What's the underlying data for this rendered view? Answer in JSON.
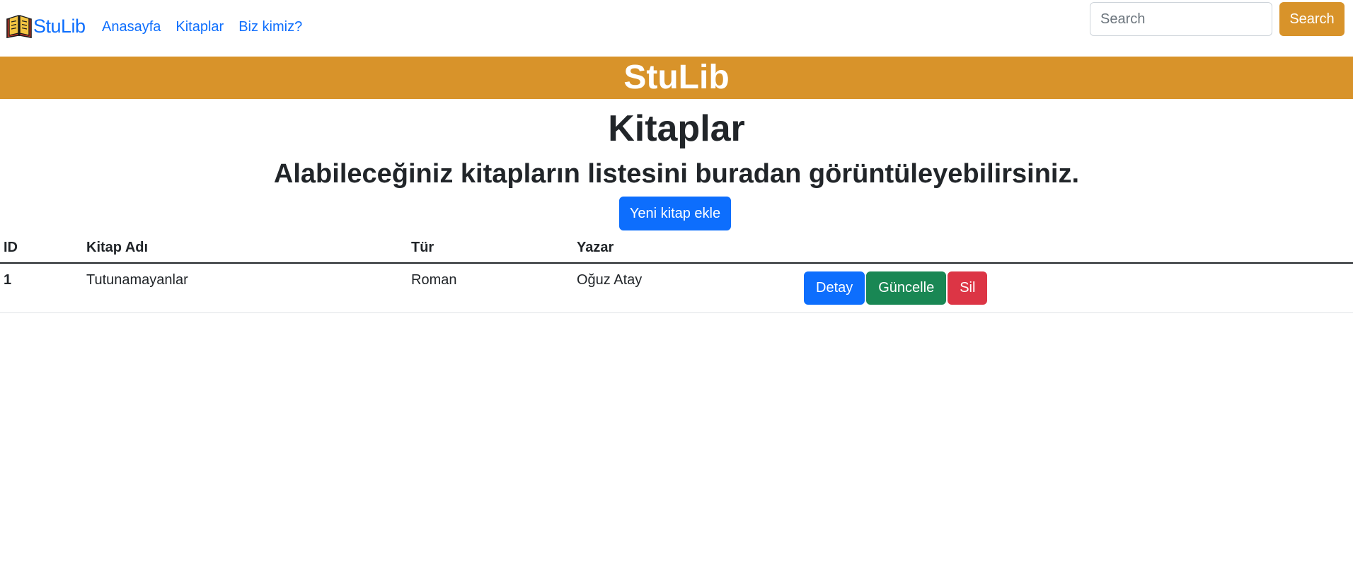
{
  "navbar": {
    "brand": "StuLib",
    "links": [
      {
        "label": "Anasayfa"
      },
      {
        "label": "Kitaplar"
      },
      {
        "label": "Biz kimiz?"
      }
    ],
    "search_placeholder": "Search",
    "search_value": "",
    "search_button": "Search"
  },
  "banner": {
    "title": "StuLib"
  },
  "main": {
    "title": "Kitaplar",
    "subtitle": "Alabileceğiniz kitapların listesini buradan görüntüleyebilirsiniz.",
    "add_button": "Yeni kitap ekle"
  },
  "table": {
    "headers": [
      "ID",
      "Kitap Adı",
      "Tür",
      "Yazar",
      ""
    ],
    "rows": [
      {
        "id": "1",
        "name": "Tutunamayanlar",
        "type": "Roman",
        "author": "Oğuz Atay",
        "actions": {
          "detail": "Detay",
          "update": "Güncelle",
          "delete": "Sil"
        }
      }
    ]
  },
  "colors": {
    "accent": "#d8932a",
    "primary": "#0d6efd",
    "success": "#198754",
    "danger": "#dc3545"
  },
  "icons": {
    "brand_logo": "open-book-icon"
  }
}
